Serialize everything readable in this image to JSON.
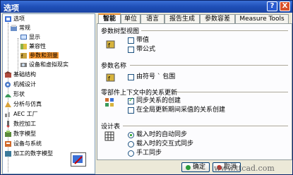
{
  "window": {
    "title": "选项",
    "help": "?",
    "close": "X"
  },
  "tree": {
    "items": [
      {
        "label": "选项"
      },
      {
        "label": "常规"
      },
      {
        "label": "显示"
      },
      {
        "label": "兼容性"
      },
      {
        "label": "参数和测量"
      },
      {
        "label": "设备和虚拟现实"
      },
      {
        "label": "基础结构"
      },
      {
        "label": "机械设计"
      },
      {
        "label": "形状"
      },
      {
        "label": "分析与仿真"
      },
      {
        "label": "AEC 工厂"
      },
      {
        "label": "数控加工"
      },
      {
        "label": "数字模型"
      },
      {
        "label": "设备与系统"
      },
      {
        "label": "加工的数字模型"
      }
    ]
  },
  "tabs": [
    "智能",
    "单位",
    "语言",
    "报告生成",
    "参数容差",
    "Measure Tools"
  ],
  "sections": {
    "param_tree": {
      "title": "参数树型视图",
      "opt1": "带值",
      "opt2": "带公式"
    },
    "param_name": {
      "title": "参数名称",
      "opt1": "由符号 ` 包围"
    },
    "relations": {
      "title": "零部件上下文中的关系更新",
      "opt1": "同步关系的创建",
      "opt2": "在全局更新期间采值的关系创建"
    },
    "design_table": {
      "title": "设计表",
      "opt1": "载入时的自动同步",
      "opt2": "载入时的交互式同步",
      "opt3": "手工同步"
    }
  },
  "buttons": {
    "ok": "确定",
    "cancel": "取消"
  },
  "watermark": "www.ttcad.com",
  "colors": {
    "accent": "#e68b2c",
    "title_bar": "#1f4fb8",
    "selected": "#ff9a2e"
  }
}
